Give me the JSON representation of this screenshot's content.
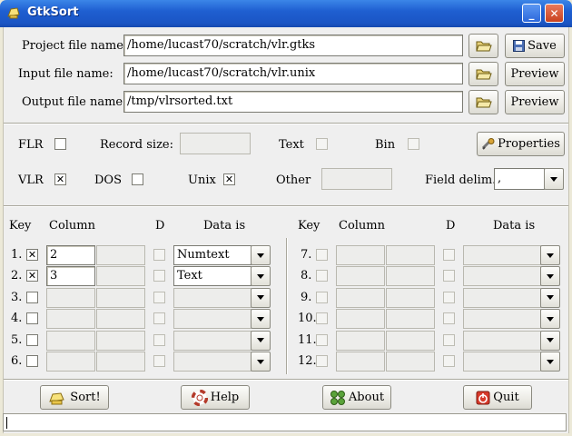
{
  "window": {
    "title": "GtkSort",
    "minimize": "_",
    "close": "✕"
  },
  "files": {
    "project_label": "Project file name:",
    "project_value": "/home/lucast70/scratch/vlr.gtks",
    "input_label": "Input file name:",
    "input_value": "/home/lucast70/scratch/vlr.unix",
    "output_label": "Output file name:",
    "output_value": "/tmp/vlrsorted.txt",
    "save_label": "Save",
    "preview_label": "Preview"
  },
  "options": {
    "flr": "FLR",
    "record_size": "Record size:",
    "text": "Text",
    "bin": "Bin",
    "properties": "Properties",
    "vlr": "VLR",
    "dos": "DOS",
    "unix": "Unix",
    "other": "Other",
    "field_delim": "Field delim.:",
    "field_delim_value": ","
  },
  "keys": {
    "headers": {
      "key": "Key",
      "column": "Column",
      "d": "D",
      "data_is": "Data is"
    },
    "rows": [
      {
        "num": "1.",
        "checked": true,
        "col": "2",
        "type": "Numtext"
      },
      {
        "num": "2.",
        "checked": true,
        "col": "3",
        "type": "Text"
      },
      {
        "num": "3.",
        "checked": false,
        "col": "",
        "type": ""
      },
      {
        "num": "4.",
        "checked": false,
        "col": "",
        "type": ""
      },
      {
        "num": "5.",
        "checked": false,
        "col": "",
        "type": ""
      },
      {
        "num": "6.",
        "checked": false,
        "col": "",
        "type": ""
      },
      {
        "num": "7.",
        "checked": false,
        "col": "",
        "type": ""
      },
      {
        "num": "8.",
        "checked": false,
        "col": "",
        "type": ""
      },
      {
        "num": "9.",
        "checked": false,
        "col": "",
        "type": ""
      },
      {
        "num": "10.",
        "checked": false,
        "col": "",
        "type": ""
      },
      {
        "num": "11.",
        "checked": false,
        "col": "",
        "type": ""
      },
      {
        "num": "12.",
        "checked": false,
        "col": "",
        "type": ""
      }
    ]
  },
  "actions": {
    "sort": "Sort!",
    "help": "Help",
    "about": "About",
    "quit": "Quit"
  },
  "colors": {
    "titlebar": "#1f5fd1",
    "check_mark": "✕"
  }
}
